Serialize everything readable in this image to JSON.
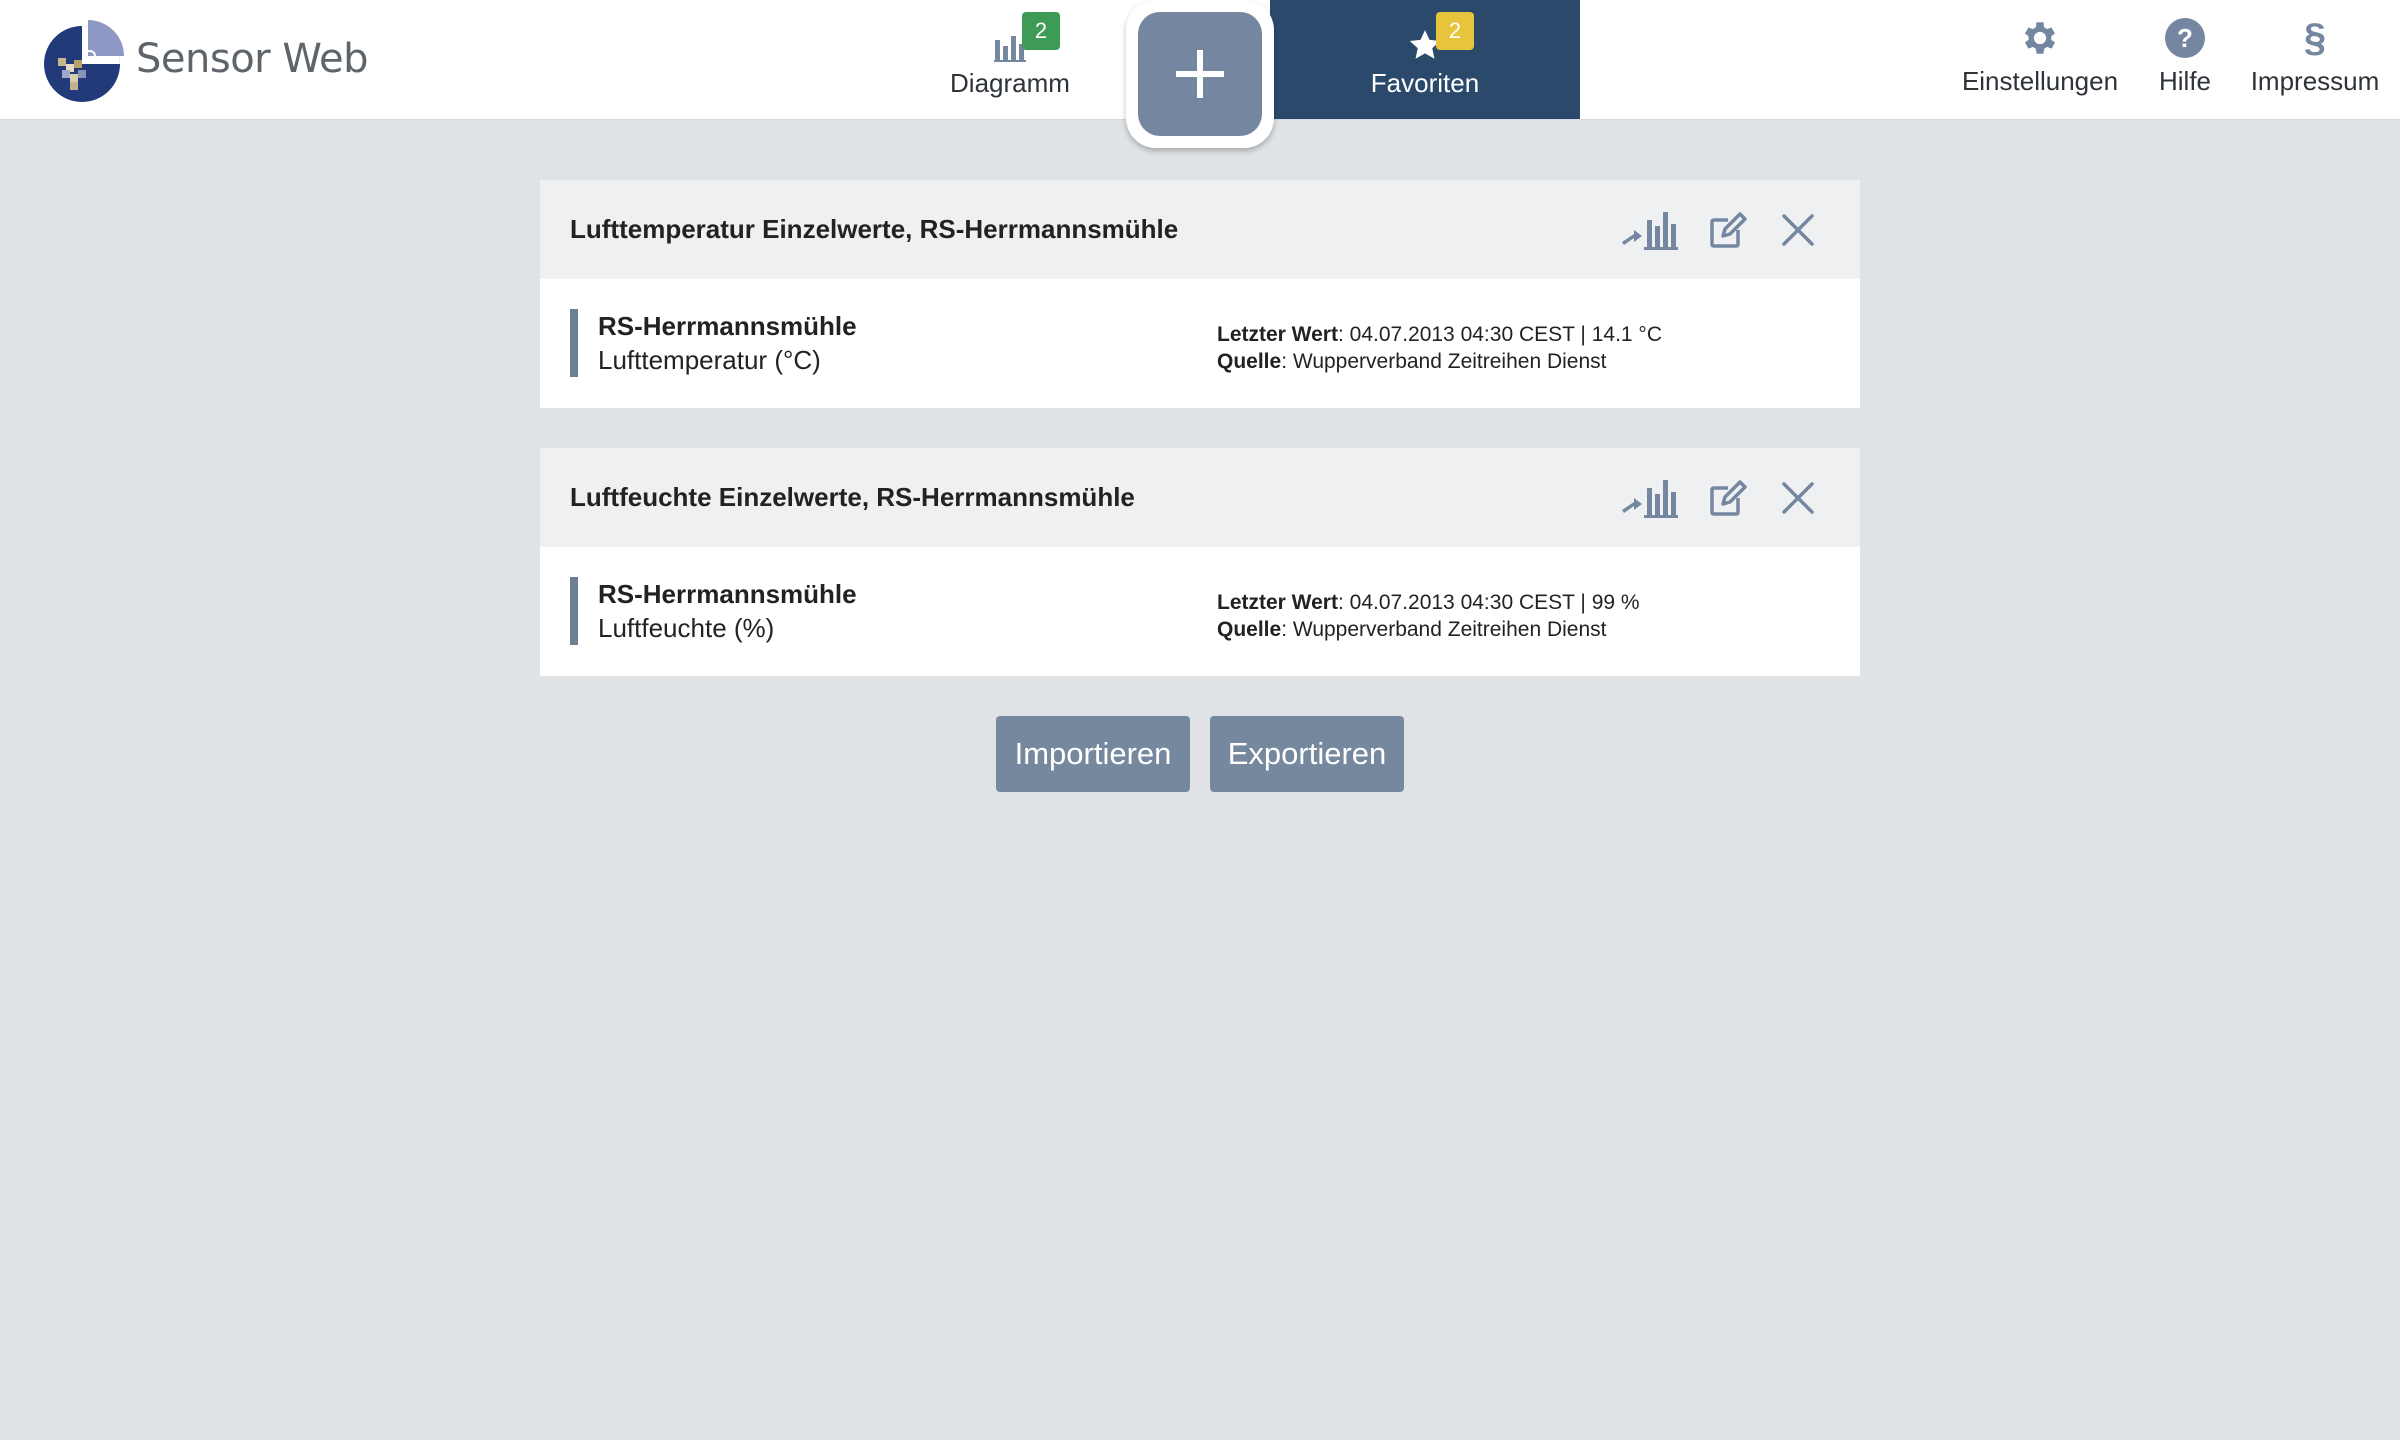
{
  "app": {
    "title": "Sensor Web"
  },
  "nav": {
    "diagram": {
      "label": "Diagramm",
      "badge": "2",
      "icon": "bar-chart-icon"
    },
    "add": {
      "icon": "plus-icon"
    },
    "favorites": {
      "label": "Favoriten",
      "badge": "2",
      "icon": "star-icon"
    },
    "settings": {
      "label": "Einstellungen",
      "icon": "gear-icon"
    },
    "help": {
      "label": "Hilfe",
      "icon": "question-icon",
      "glyph": "?"
    },
    "impressum": {
      "label": "Impressum",
      "icon": "section-sign-icon",
      "glyph": "§"
    }
  },
  "favorites": [
    {
      "title": "Lufttemperatur Einzelwerte, RS-Herrmannsmühle",
      "station": "RS-Herrmannsmühle",
      "phenomenon": "Lufttemperatur (°C)",
      "last_value_label": "Letzter Wert",
      "last_value": ": 04.07.2013 04:30 CEST | 14.1 °C",
      "source_label": "Quelle",
      "source": ": Wupperverband Zeitreihen Dienst"
    },
    {
      "title": "Luftfeuchte Einzelwerte, RS-Herrmannsmühle",
      "station": "RS-Herrmannsmühle",
      "phenomenon": "Luftfeuchte (%)",
      "last_value_label": "Letzter Wert",
      "last_value": ": 04.07.2013 04:30 CEST | 99 %",
      "source_label": "Quelle",
      "source": ": Wupperverband Zeitreihen Dienst"
    }
  ],
  "actions": {
    "import_label": "Importieren",
    "export_label": "Exportieren"
  },
  "colors": {
    "header_active": "#2b4a6b",
    "badge_green": "#3d9b56",
    "badge_yellow": "#e8c33c",
    "button": "#76889e",
    "icon": "#7587a0",
    "background": "#dfe3e6"
  }
}
